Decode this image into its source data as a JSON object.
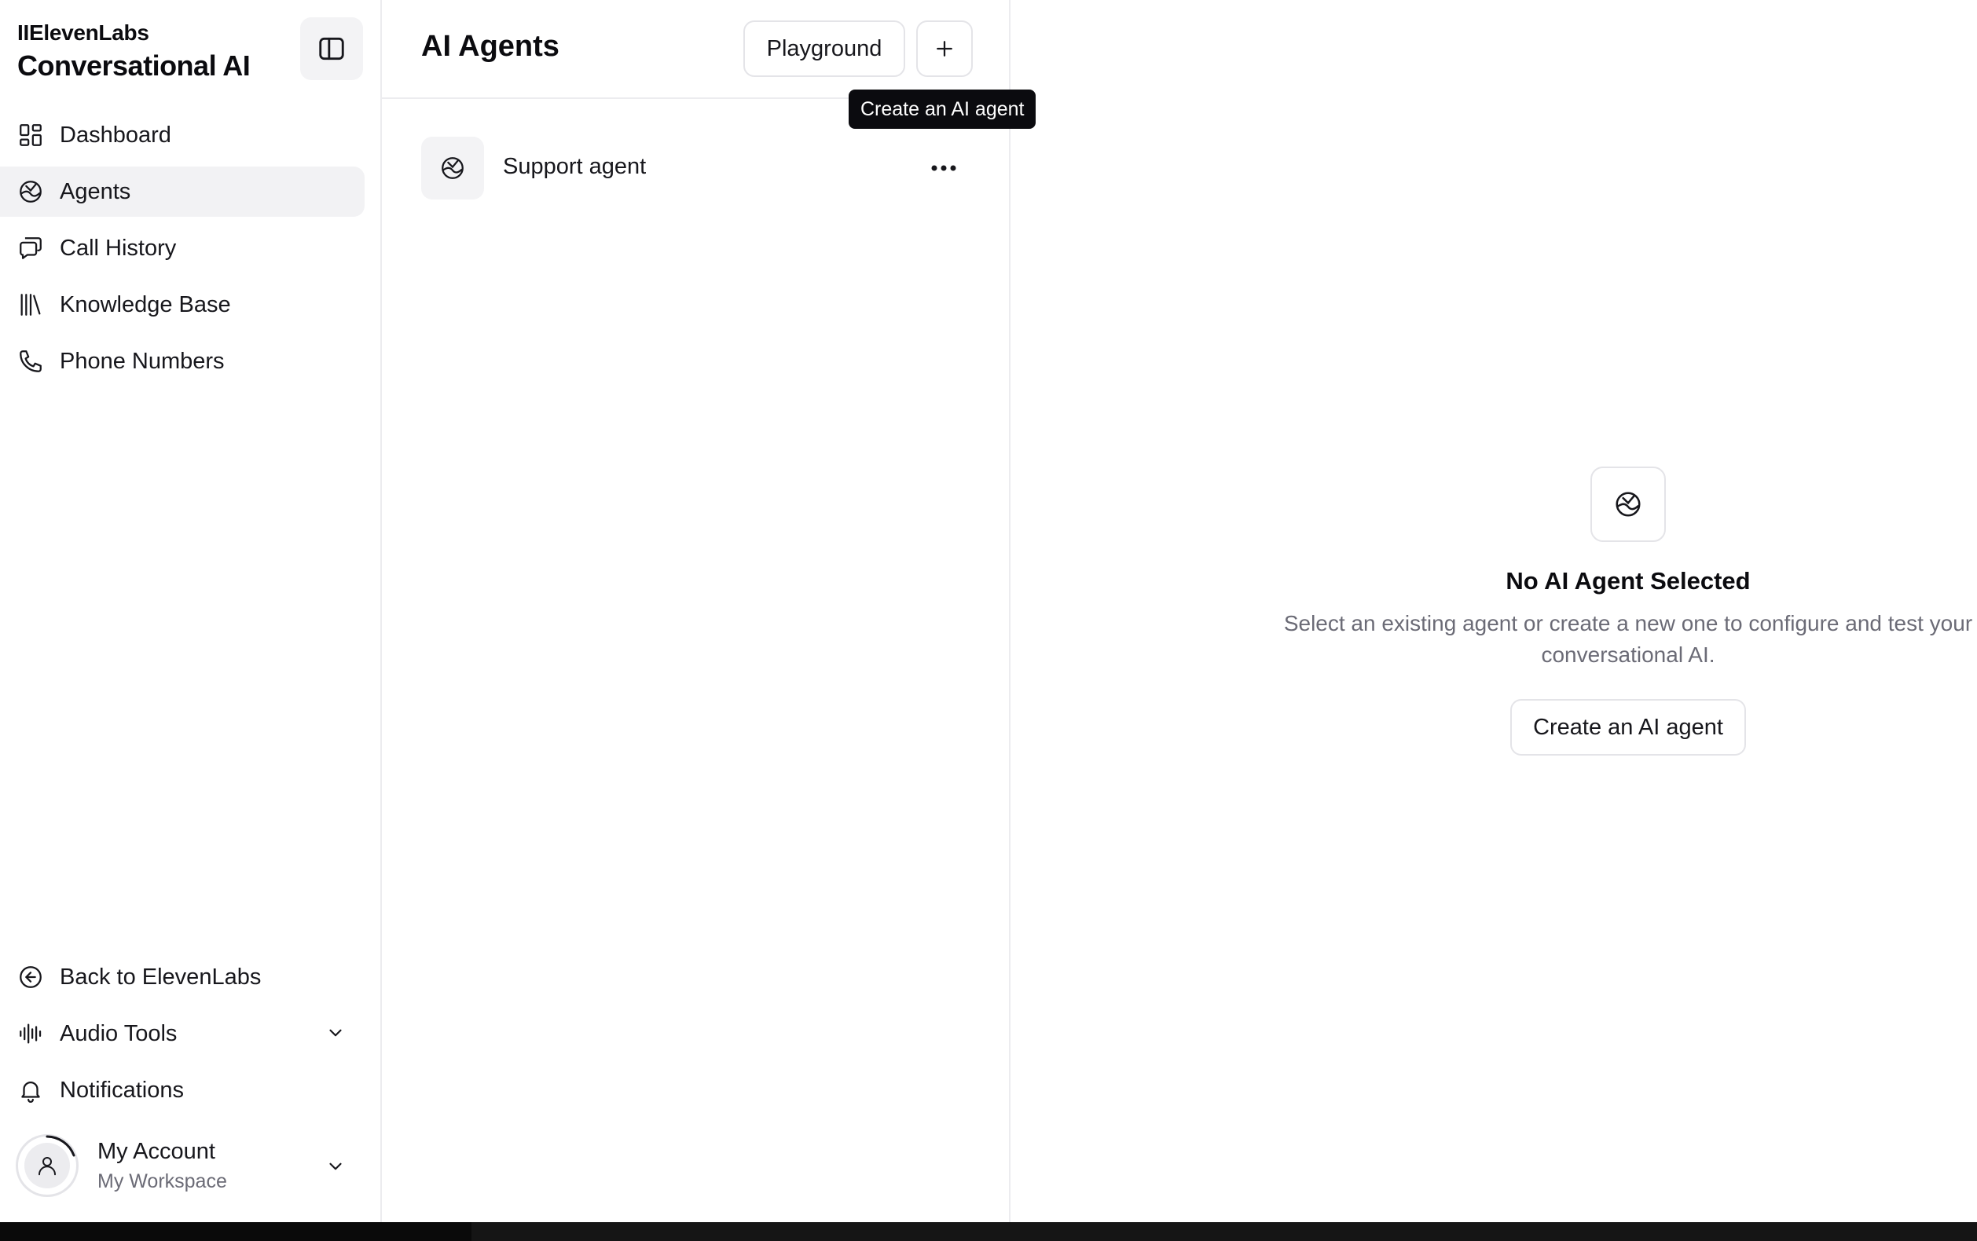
{
  "brand": {
    "top": "IIElevenLabs",
    "main": "Conversational AI"
  },
  "sidebar": {
    "items": [
      {
        "label": "Dashboard",
        "icon": "dashboard-icon"
      },
      {
        "label": "Agents",
        "icon": "agents-icon",
        "active": true
      },
      {
        "label": "Call History",
        "icon": "chat-icon"
      },
      {
        "label": "Knowledge Base",
        "icon": "library-icon"
      },
      {
        "label": "Phone Numbers",
        "icon": "phone-icon"
      }
    ],
    "bottom_items": [
      {
        "label": "Back to ElevenLabs",
        "icon": "arrow-left-circle-icon"
      },
      {
        "label": "Audio Tools",
        "icon": "audio-waveform-icon"
      },
      {
        "label": "Notifications",
        "icon": "bell-icon"
      }
    ],
    "account": {
      "name": "My Account",
      "workspace": "My Workspace"
    }
  },
  "list": {
    "title": "AI Agents",
    "playground_label": "Playground",
    "tooltip": "Create an AI agent",
    "agents": [
      {
        "name": "Support agent"
      }
    ]
  },
  "detail": {
    "title": "No AI Agent Selected",
    "description": "Select an existing agent or create a new one to configure and test your conversational AI.",
    "button_label": "Create an AI agent"
  },
  "colors": {
    "border": "#ececef",
    "active_bg": "#f2f2f4",
    "muted_text": "#6b6b76",
    "tooltip_bg": "#0b0b0f"
  }
}
